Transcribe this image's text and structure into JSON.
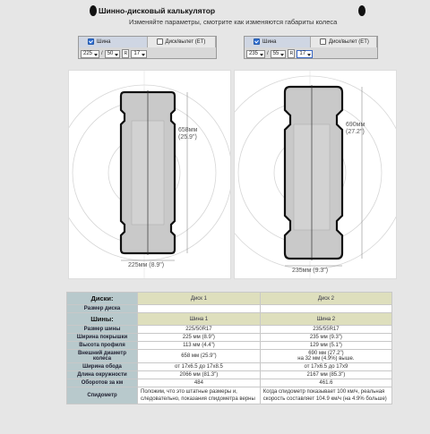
{
  "header": {
    "title": "Шинно-дисковый калькулятор",
    "subtitle": "Измeняйте параметры, смотрите как изменяются габариты колеса"
  },
  "tire1": {
    "tab_tire": "Шина",
    "tab_disk": "Диск/вылет (ET)",
    "width": "225",
    "profile": "50",
    "r": "R",
    "diameter": "17",
    "dim_height": "658мм",
    "dim_height_in": "(25.9\")",
    "dim_width": "225мм (8.9\")"
  },
  "tire2": {
    "tab_tire": "Шина",
    "tab_disk": "Диск/вылет (ET)",
    "width": "235",
    "profile": "55",
    "r": "R",
    "diameter": "17",
    "dim_height": "690мм",
    "dim_height_in": "(27.2\")",
    "dim_width": "235мм (9.3\")"
  },
  "sep": "/",
  "table": {
    "disks_label": "Диски:",
    "disk1": "Диск 1",
    "disk2": "Диск 2",
    "disk_size_label": "Размер диска",
    "tires_label": "Шины:",
    "tire1": "Шина 1",
    "tire2": "Шина 2",
    "rows": [
      {
        "label": "Размер шины",
        "v1": "225/50R17",
        "v2": "235/55R17"
      },
      {
        "label": "Ширина покрышки",
        "v1": "225 мм (8.9\")",
        "v2": "235 мм (9.3\")"
      },
      {
        "label": "Высота профиля",
        "v1": "113 мм (4.4\")",
        "v2": "129 мм (5.1\")"
      },
      {
        "label": "Внешний диаметр колеса",
        "v1": "658 мм (25.9\")",
        "v2": "690 мм (27.2\")",
        "v2b": "на 32 мм (4.9%) выше."
      },
      {
        "label": "Ширина обода",
        "v1": "от 17x6.5 до 17x8.5",
        "v2": "от 17x6.5 до 17x9"
      },
      {
        "label": "Длина окружности",
        "v1": "2066 мм (81.3\")",
        "v2": "2167 мм (85.3\")"
      },
      {
        "label": "Оборотов за км",
        "v1": "484",
        "v2": "461.6"
      }
    ],
    "speedo_label": "Спидометр",
    "speedo1": "Положим, что это штатные размеры и, следовательно, показания спидометра верны",
    "speedo2": "Когда спидометр показывает 100 км/ч, реальная скорость составляет 104.9 км/ч (на 4.9% больше)"
  }
}
